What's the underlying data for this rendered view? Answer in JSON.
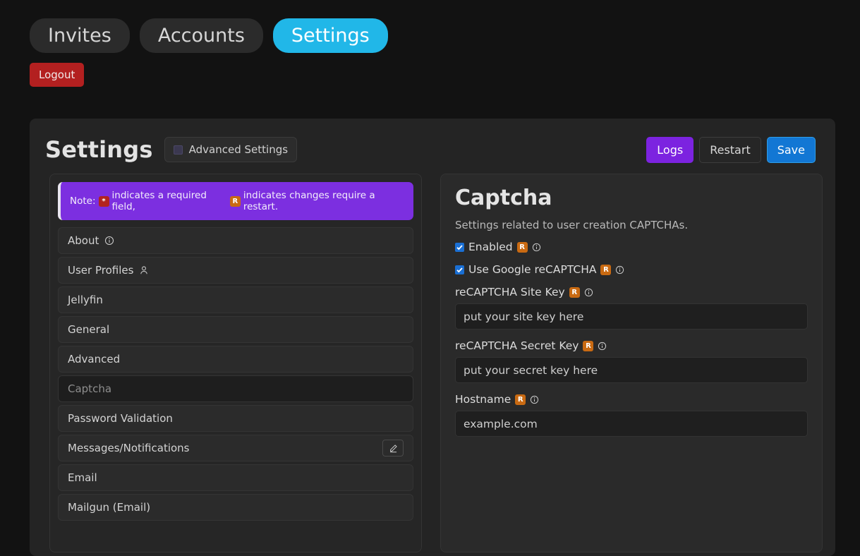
{
  "nav": {
    "tabs": [
      {
        "label": "Invites",
        "active": false
      },
      {
        "label": "Accounts",
        "active": false
      },
      {
        "label": "Settings",
        "active": true
      }
    ],
    "logout_label": "Logout"
  },
  "header": {
    "title": "Settings",
    "advanced_label": "Advanced Settings",
    "advanced_checked": false,
    "logs_label": "Logs",
    "restart_label": "Restart",
    "save_label": "Save"
  },
  "note": {
    "prefix": "Note:",
    "required_badge": "*",
    "required_text": "indicates a required field,",
    "restart_badge": "R",
    "restart_text": "indicates changes require a restart."
  },
  "sidebar": {
    "items": [
      {
        "label": "About",
        "icon": "info-icon",
        "selected": false,
        "edit": false
      },
      {
        "label": "User Profiles",
        "icon": "user-icon",
        "selected": false,
        "edit": false
      },
      {
        "label": "Jellyfin",
        "icon": "",
        "selected": false,
        "edit": false
      },
      {
        "label": "General",
        "icon": "",
        "selected": false,
        "edit": false
      },
      {
        "label": "Advanced",
        "icon": "",
        "selected": false,
        "edit": false
      },
      {
        "label": "Captcha",
        "icon": "",
        "selected": true,
        "edit": false
      },
      {
        "label": "Password Validation",
        "icon": "",
        "selected": false,
        "edit": false
      },
      {
        "label": "Messages/Notifications",
        "icon": "",
        "selected": false,
        "edit": true
      },
      {
        "label": "Email",
        "icon": "",
        "selected": false,
        "edit": false
      },
      {
        "label": "Mailgun (Email)",
        "icon": "",
        "selected": false,
        "edit": false
      }
    ]
  },
  "section": {
    "title": "Captcha",
    "description": "Settings related to user creation CAPTCHAs.",
    "checkboxes": [
      {
        "label": "Enabled",
        "checked": true,
        "restart_badge": "R"
      },
      {
        "label": "Use Google reCAPTCHA",
        "checked": true,
        "restart_badge": "R"
      }
    ],
    "fields": [
      {
        "label": "reCAPTCHA Site Key",
        "restart_badge": "R",
        "value": "put your site key here"
      },
      {
        "label": "reCAPTCHA Secret Key",
        "restart_badge": "R",
        "value": "put your secret key here"
      },
      {
        "label": "Hostname",
        "restart_badge": "R",
        "value": "example.com"
      }
    ]
  },
  "colors": {
    "accent_blue": "#21b7e8",
    "purple": "#7c2fe0",
    "save_blue": "#1277d4",
    "logout_red": "#b32020",
    "restart_orange": "#c96a12",
    "required_red": "#b3231f"
  }
}
